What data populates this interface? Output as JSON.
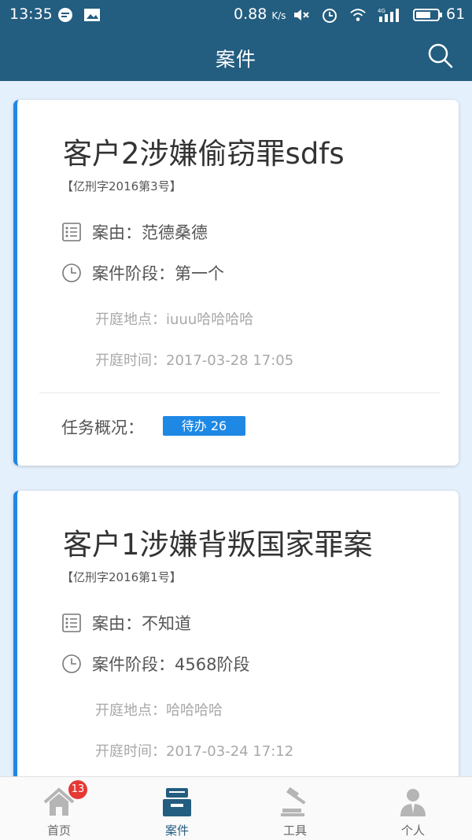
{
  "status_bar": {
    "time": "13:35",
    "speed": "0.88",
    "speed_unit": "K/s",
    "network": "4G",
    "battery": "61"
  },
  "app_bar": {
    "title": "案件"
  },
  "cases": [
    {
      "title": "客户2涉嫌偷窃罪sdfs",
      "number": "【亿刑字2016第3号】",
      "cause_label": "案由：",
      "cause": "范德桑德",
      "stage_label": "案件阶段：",
      "stage": "第一个",
      "court_place_label": "开庭地点：",
      "court_place": "iuuu哈哈哈哈",
      "court_time_label": "开庭时间：",
      "court_time": "2017-03-28 17:05",
      "task_label": "任务概况：",
      "task_badge": "待办 26"
    },
    {
      "title": "客户1涉嫌背叛国家罪案",
      "number": "【亿刑字2016第1号】",
      "cause_label": "案由：",
      "cause": "不知道",
      "stage_label": "案件阶段：",
      "stage": "4568阶段",
      "court_place_label": "开庭地点：",
      "court_place": "哈哈哈哈",
      "court_time_label": "开庭时间：",
      "court_time": "2017-03-24 17:12"
    }
  ],
  "tabs": [
    {
      "label": "首页",
      "badge": "13",
      "icon": "home-icon"
    },
    {
      "label": "案件",
      "icon": "case-icon"
    },
    {
      "label": "工具",
      "icon": "gavel-icon"
    },
    {
      "label": "个人",
      "icon": "person-icon"
    }
  ],
  "colors": {
    "primary": "#235d80",
    "accent": "#1e88e5",
    "background": "#e4f0fb",
    "badge": "#e53935"
  }
}
